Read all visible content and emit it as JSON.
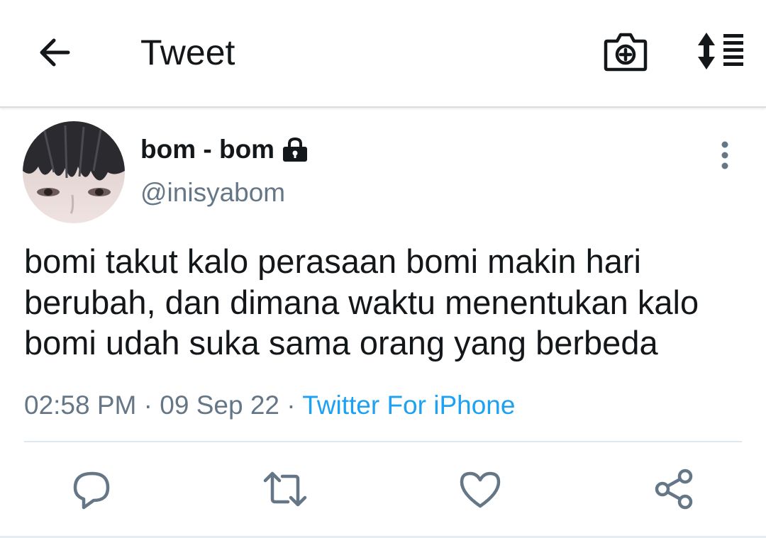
{
  "header": {
    "title": "Tweet",
    "back_icon": "arrow-left-icon",
    "camera_icon": "camera-plus-icon",
    "thread_icon": "sort-thread-icon"
  },
  "tweet": {
    "display_name": "bom - bom",
    "protected_icon": "lock-icon",
    "handle": "@inisyabom",
    "text": "bomi takut kalo perasaan bomi makin hari berubah, dan dimana waktu menentukan kalo bomi udah suka sama orang yang berbeda",
    "time": "02:58 PM",
    "separator": " · ",
    "date": "09 Sep 22",
    "source": "Twitter For iPhone",
    "more_icon": "more-vertical-icon"
  },
  "actions": {
    "reply_icon": "reply-icon",
    "retweet_icon": "retweet-icon",
    "like_icon": "heart-icon",
    "share_icon": "share-icon"
  },
  "colors": {
    "text": "#14171a",
    "secondary": "#657786",
    "accent": "#1da1f2",
    "divider": "#e1e8ed"
  }
}
